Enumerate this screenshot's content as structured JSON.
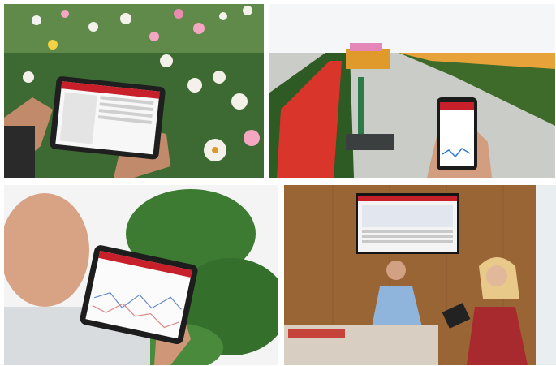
{
  "photos": [
    {
      "subject": "tablet-among-gerbera-flowers"
    },
    {
      "subject": "phone-in-greenhouse"
    },
    {
      "subject": "tablet-near-tomato-plant"
    },
    {
      "subject": "meeting-room-with-dashboard-screen"
    }
  ],
  "colors": {
    "app_red": "#c8202a",
    "foliage": "#2f5a2a",
    "wood": "#9a6535",
    "shirt_blue": "#8fb5dd"
  }
}
